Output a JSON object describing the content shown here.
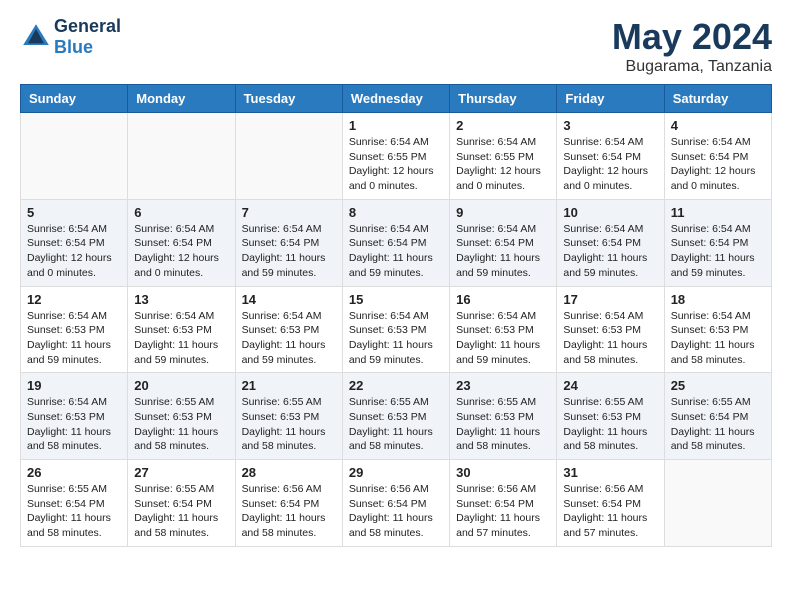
{
  "header": {
    "logo_line1": "General",
    "logo_line2": "Blue",
    "month_year": "May 2024",
    "location": "Bugarama, Tanzania"
  },
  "weekdays": [
    "Sunday",
    "Monday",
    "Tuesday",
    "Wednesday",
    "Thursday",
    "Friday",
    "Saturday"
  ],
  "weeks": [
    [
      {
        "day": "",
        "info": ""
      },
      {
        "day": "",
        "info": ""
      },
      {
        "day": "",
        "info": ""
      },
      {
        "day": "1",
        "info": "Sunrise: 6:54 AM\nSunset: 6:55 PM\nDaylight: 12 hours\nand 0 minutes."
      },
      {
        "day": "2",
        "info": "Sunrise: 6:54 AM\nSunset: 6:55 PM\nDaylight: 12 hours\nand 0 minutes."
      },
      {
        "day": "3",
        "info": "Sunrise: 6:54 AM\nSunset: 6:54 PM\nDaylight: 12 hours\nand 0 minutes."
      },
      {
        "day": "4",
        "info": "Sunrise: 6:54 AM\nSunset: 6:54 PM\nDaylight: 12 hours\nand 0 minutes."
      }
    ],
    [
      {
        "day": "5",
        "info": "Sunrise: 6:54 AM\nSunset: 6:54 PM\nDaylight: 12 hours\nand 0 minutes."
      },
      {
        "day": "6",
        "info": "Sunrise: 6:54 AM\nSunset: 6:54 PM\nDaylight: 12 hours\nand 0 minutes."
      },
      {
        "day": "7",
        "info": "Sunrise: 6:54 AM\nSunset: 6:54 PM\nDaylight: 11 hours\nand 59 minutes."
      },
      {
        "day": "8",
        "info": "Sunrise: 6:54 AM\nSunset: 6:54 PM\nDaylight: 11 hours\nand 59 minutes."
      },
      {
        "day": "9",
        "info": "Sunrise: 6:54 AM\nSunset: 6:54 PM\nDaylight: 11 hours\nand 59 minutes."
      },
      {
        "day": "10",
        "info": "Sunrise: 6:54 AM\nSunset: 6:54 PM\nDaylight: 11 hours\nand 59 minutes."
      },
      {
        "day": "11",
        "info": "Sunrise: 6:54 AM\nSunset: 6:54 PM\nDaylight: 11 hours\nand 59 minutes."
      }
    ],
    [
      {
        "day": "12",
        "info": "Sunrise: 6:54 AM\nSunset: 6:53 PM\nDaylight: 11 hours\nand 59 minutes."
      },
      {
        "day": "13",
        "info": "Sunrise: 6:54 AM\nSunset: 6:53 PM\nDaylight: 11 hours\nand 59 minutes."
      },
      {
        "day": "14",
        "info": "Sunrise: 6:54 AM\nSunset: 6:53 PM\nDaylight: 11 hours\nand 59 minutes."
      },
      {
        "day": "15",
        "info": "Sunrise: 6:54 AM\nSunset: 6:53 PM\nDaylight: 11 hours\nand 59 minutes."
      },
      {
        "day": "16",
        "info": "Sunrise: 6:54 AM\nSunset: 6:53 PM\nDaylight: 11 hours\nand 59 minutes."
      },
      {
        "day": "17",
        "info": "Sunrise: 6:54 AM\nSunset: 6:53 PM\nDaylight: 11 hours\nand 58 minutes."
      },
      {
        "day": "18",
        "info": "Sunrise: 6:54 AM\nSunset: 6:53 PM\nDaylight: 11 hours\nand 58 minutes."
      }
    ],
    [
      {
        "day": "19",
        "info": "Sunrise: 6:54 AM\nSunset: 6:53 PM\nDaylight: 11 hours\nand 58 minutes."
      },
      {
        "day": "20",
        "info": "Sunrise: 6:55 AM\nSunset: 6:53 PM\nDaylight: 11 hours\nand 58 minutes."
      },
      {
        "day": "21",
        "info": "Sunrise: 6:55 AM\nSunset: 6:53 PM\nDaylight: 11 hours\nand 58 minutes."
      },
      {
        "day": "22",
        "info": "Sunrise: 6:55 AM\nSunset: 6:53 PM\nDaylight: 11 hours\nand 58 minutes."
      },
      {
        "day": "23",
        "info": "Sunrise: 6:55 AM\nSunset: 6:53 PM\nDaylight: 11 hours\nand 58 minutes."
      },
      {
        "day": "24",
        "info": "Sunrise: 6:55 AM\nSunset: 6:53 PM\nDaylight: 11 hours\nand 58 minutes."
      },
      {
        "day": "25",
        "info": "Sunrise: 6:55 AM\nSunset: 6:54 PM\nDaylight: 11 hours\nand 58 minutes."
      }
    ],
    [
      {
        "day": "26",
        "info": "Sunrise: 6:55 AM\nSunset: 6:54 PM\nDaylight: 11 hours\nand 58 minutes."
      },
      {
        "day": "27",
        "info": "Sunrise: 6:55 AM\nSunset: 6:54 PM\nDaylight: 11 hours\nand 58 minutes."
      },
      {
        "day": "28",
        "info": "Sunrise: 6:56 AM\nSunset: 6:54 PM\nDaylight: 11 hours\nand 58 minutes."
      },
      {
        "day": "29",
        "info": "Sunrise: 6:56 AM\nSunset: 6:54 PM\nDaylight: 11 hours\nand 58 minutes."
      },
      {
        "day": "30",
        "info": "Sunrise: 6:56 AM\nSunset: 6:54 PM\nDaylight: 11 hours\nand 57 minutes."
      },
      {
        "day": "31",
        "info": "Sunrise: 6:56 AM\nSunset: 6:54 PM\nDaylight: 11 hours\nand 57 minutes."
      },
      {
        "day": "",
        "info": ""
      }
    ]
  ]
}
